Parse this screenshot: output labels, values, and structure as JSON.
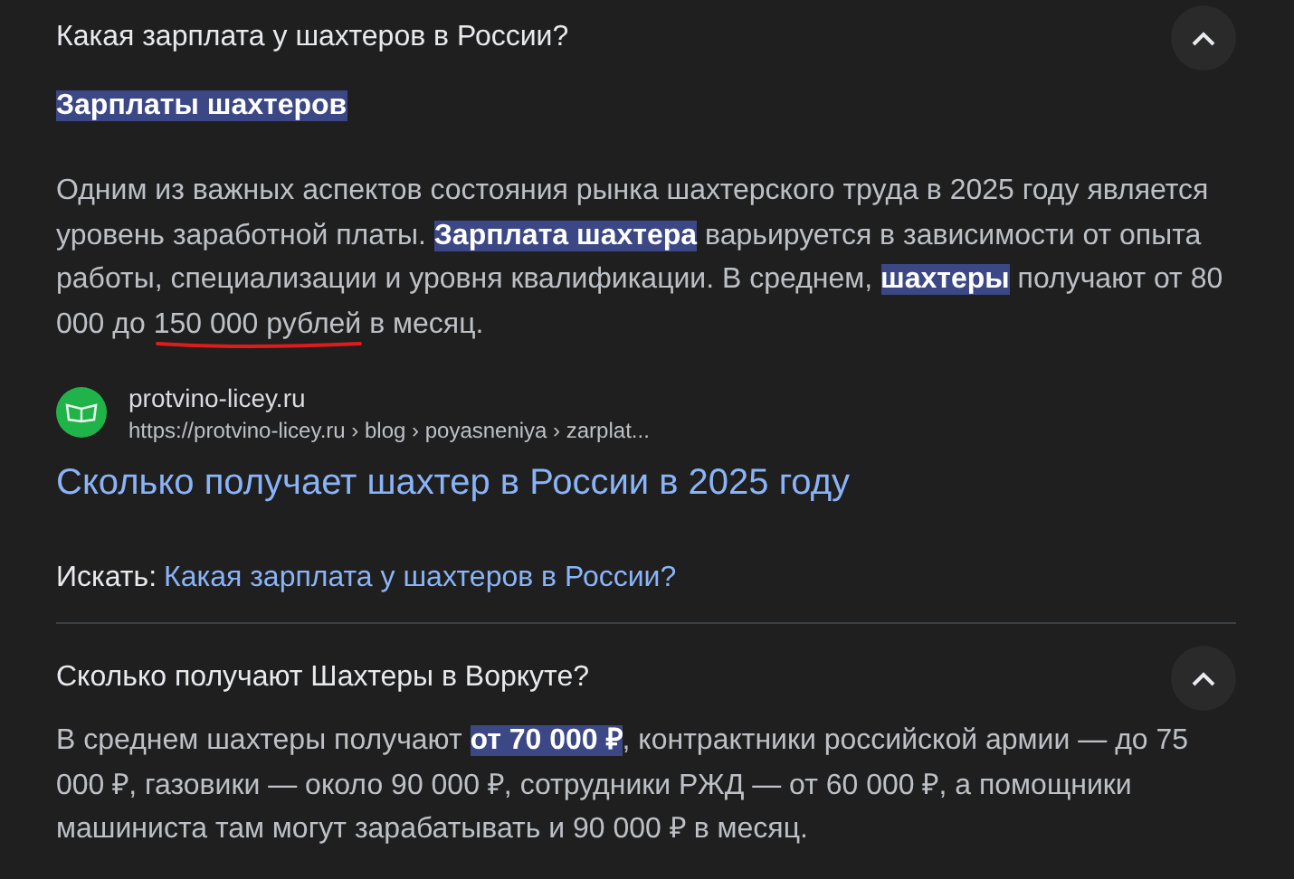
{
  "questions": [
    {
      "question": "Какая зарплата у шахтеров в России?",
      "expanded": true,
      "answer_title": "Зарплаты шахтеров",
      "answer": "Одним из важных аспектов состояния рынка шахтерского труда в 2025 году является уровень заработной платы. **Зарплата шахтера** варьируется в зависимости от опыта работы, специализации и уровня квалификации. В среднем, **шахтеры** получают от 80 000 до 150 000 рублей в месяц.",
      "hand_underline": true,
      "source": {
        "site": "protvino-licey.ru",
        "url": "https://protvino-licey.ru › blog › poyasneniya › zarplat...",
        "title": "Сколько получает шахтер в России в 2025 году"
      },
      "search_label": "Искать:",
      "search_link": "Какая зарплата у шахтеров в России?"
    },
    {
      "question": "Сколько получают Шахтеры в Воркуте?",
      "expanded": true,
      "answer": "В среднем шахтеры получают **от 70 000 ₽**, контрактники российской армии — до 75 000 ₽, газовики — около 90 000 ₽, сотрудники РЖД — от 60 000 ₽, а помощники машиниста там могут зарабатывать и 90 000 ₽ в месяц."
    }
  ]
}
